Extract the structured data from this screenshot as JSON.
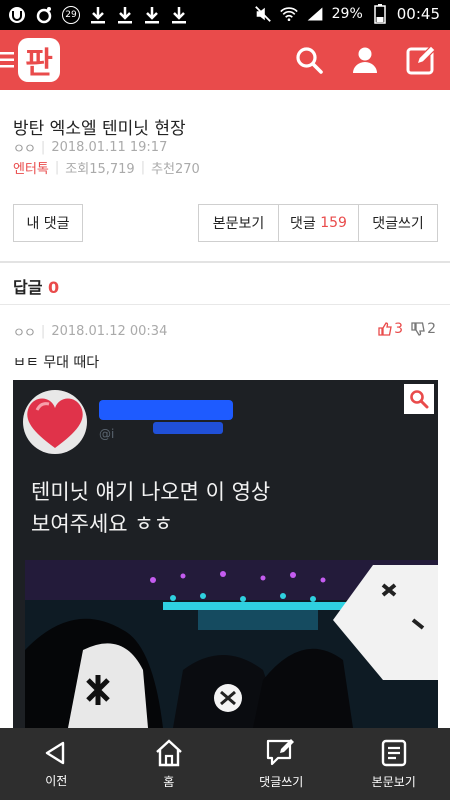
{
  "status_bar": {
    "badge_count": "29",
    "battery_percent": "29%",
    "time": "00:45"
  },
  "header": {
    "logo_text": "판",
    "brand_color": "#e94b4b"
  },
  "post": {
    "title": "방탄 엑소엘 텐미닛 현장",
    "author": "ㅇㅇ",
    "date": "2018.01.11 19:17",
    "category": "엔터톡",
    "views": "조회15,719",
    "recommends": "추천270"
  },
  "buttons": {
    "my_comments": "내 댓글",
    "view_body": "본문보기",
    "comments_label": "댓글",
    "comments_count": "159",
    "write_comment": "댓글쓰기"
  },
  "replies": {
    "label": "답글",
    "count": "0"
  },
  "comment": {
    "author": "ㅇㅇ",
    "date": "2018.01.12 00:34",
    "upvotes": "3",
    "downvotes": "2",
    "text": "ㅂㅌ 무대 때다",
    "image": {
      "handle": "@i",
      "tweet_line1": "텐미닛 얘기 나오면 이 영상",
      "tweet_line2": "보여주세요 ㅎㅎ"
    }
  },
  "bottom_nav": {
    "prev": "이전",
    "home": "홈",
    "write": "댓글쓰기",
    "body": "본문보기"
  }
}
